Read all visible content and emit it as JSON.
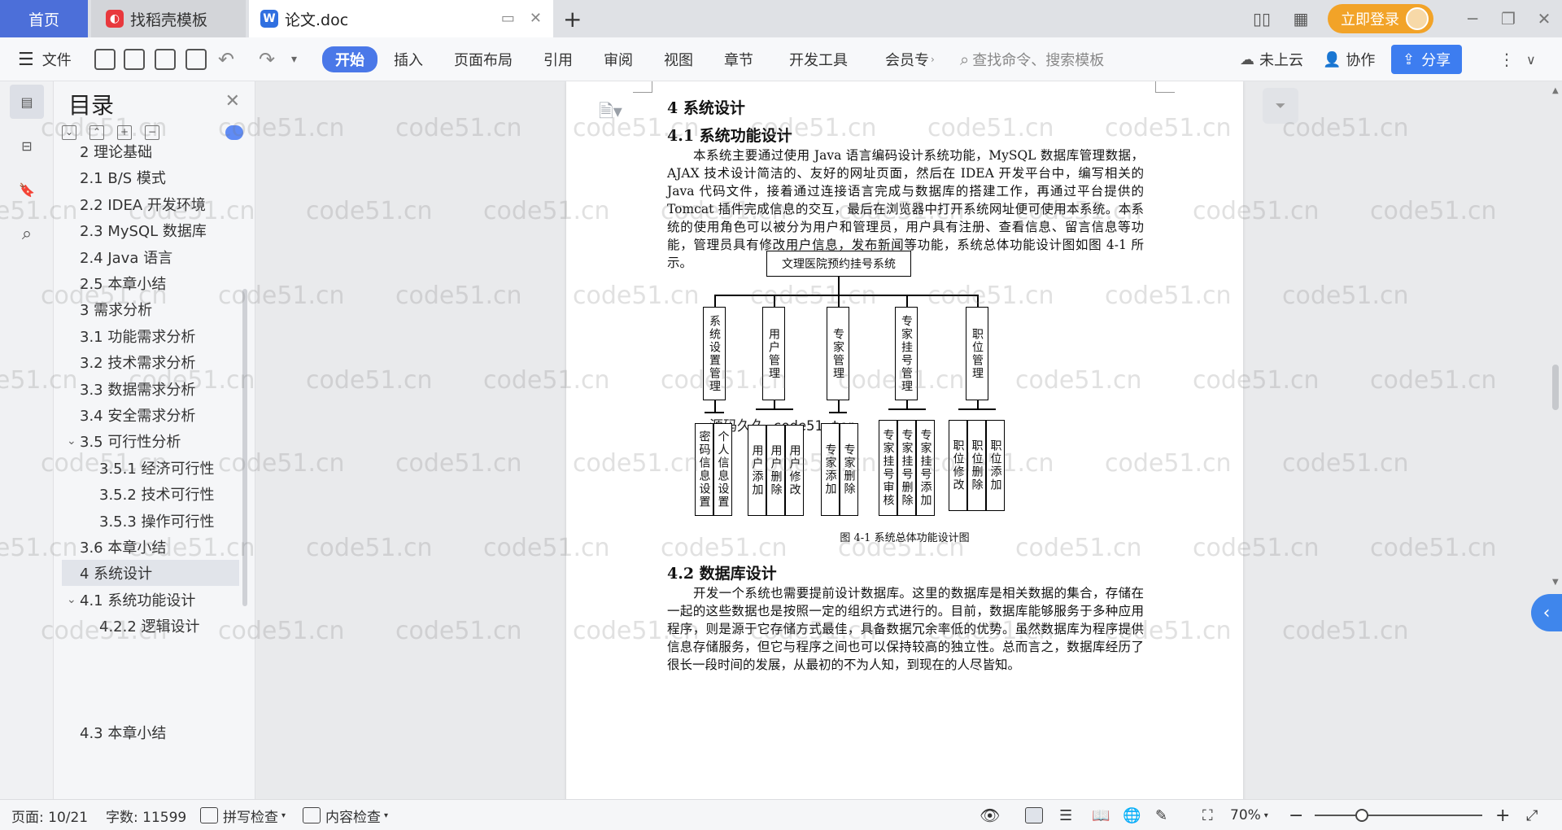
{
  "tabs": {
    "home": "首页",
    "template": "找稻壳模板",
    "doc": "论文.doc"
  },
  "window": {
    "login": "立即登录"
  },
  "toolbar": {
    "file": "文件",
    "start": "开始",
    "insert": "插入",
    "layout": "页面布局",
    "reference": "引用",
    "review": "审阅",
    "view": "视图",
    "chapter": "章节",
    "devtools": "开发工具",
    "member": "会员专",
    "search_placeholder": "查找命令、搜索模板",
    "cloud": "未上云",
    "collab": "协作",
    "share": "分享"
  },
  "toc": {
    "title": "目录",
    "items": [
      {
        "label": "2 理论基础",
        "level": 1
      },
      {
        "label": "2.1 B/S 模式",
        "level": 1
      },
      {
        "label": "2.2 IDEA 开发环境",
        "level": 1
      },
      {
        "label": "2.3 MySQL 数据库",
        "level": 1
      },
      {
        "label": "2.4 Java 语言",
        "level": 1
      },
      {
        "label": "2.5 本章小结",
        "level": 1
      },
      {
        "label": "3 需求分析",
        "level": 1
      },
      {
        "label": "3.1 功能需求分析",
        "level": 1
      },
      {
        "label": "3.2 技术需求分析",
        "level": 1
      },
      {
        "label": "3.3 数据需求分析",
        "level": 1
      },
      {
        "label": "3.4 安全需求分析",
        "level": 1
      },
      {
        "label": "3.5 可行性分析",
        "level": 1,
        "expanded": true
      },
      {
        "label": "3.5.1 经济可行性",
        "level": 2
      },
      {
        "label": "3.5.2 技术可行性",
        "level": 2
      },
      {
        "label": "3.5.3 操作可行性",
        "level": 2
      },
      {
        "label": "3.6 本章小结",
        "level": 1
      },
      {
        "label": "4 系统设计",
        "level": 1,
        "active": true
      },
      {
        "label": "4.1 系统功能设计",
        "level": 1,
        "expanded": true
      },
      {
        "label": "4.2.2 逻辑设计",
        "level": 2
      },
      {
        "label": "4.3 本章小结",
        "level": 1
      }
    ]
  },
  "document": {
    "h_4": "4 系统设计",
    "h_41": "4.1 系统功能设计",
    "p_41": "本系统主要通过使用 Java 语言编码设计系统功能，MySQL 数据库管理数据，AJAX 技术设计简洁的、友好的网址页面，然后在 IDEA 开发平台中，编写相关的 Java 代码文件，接着通过连接语言完成与数据库的搭建工作，再通过平台提供的 Tomcat 插件完成信息的交互，最后在浏览器中打开系统网址便可使用本系统。本系统的使用角色可以被分为用户和管理员，用户具有注册、查看信息、留言信息等功能，管理员具有修改用户信息，发布新闻等功能，系统总体功能设计图如图 4-1 所示。",
    "figure": {
      "root": "文理医院预约挂号系统",
      "modules": [
        "系统设置管理",
        "用户管理",
        "专家管理",
        "专家挂号管理",
        "职位管理"
      ],
      "leaves": [
        [
          "密码信息设置",
          "个人信息设置"
        ],
        [
          "用户添加",
          "用户删除",
          "用户修改"
        ],
        [
          "专家添加",
          "专家删除"
        ],
        [
          "专家挂号审核",
          "专家挂号删除",
          "专家挂号添加"
        ],
        [
          "职位修改",
          "职位删除",
          "职位添加"
        ]
      ],
      "caption": "图 4-1 系统总体功能设计图",
      "overlay_text": "源码久久-code51 top"
    },
    "h_42": "4.2  数据库设计",
    "p_42": "开发一个系统也需要提前设计数据库。这里的数据库是相关数据的集合，存储在一起的这些数据也是按照一定的组织方式进行的。目前，数据库能够服务于多种应用程序，则是源于它存储方式最佳，具备数据冗余率低的优势。虽然数据库为程序提供信息存储服务，但它与程序之间也可以保持较高的独立性。总而言之，数据库经历了很长一段时间的发展，从最初的不为人知，到现在的人尽皆知。"
  },
  "watermark": "code51.cn",
  "status": {
    "page": "页面: 10/21",
    "words": "字数: 11599",
    "spell": "拼写检查",
    "content_check": "内容检查",
    "zoom": "70%",
    "zoom_fraction": 0.28
  },
  "colors": {
    "accent": "#4a78e8",
    "home_tab": "#4c6fd9",
    "login": "#f2a328"
  }
}
